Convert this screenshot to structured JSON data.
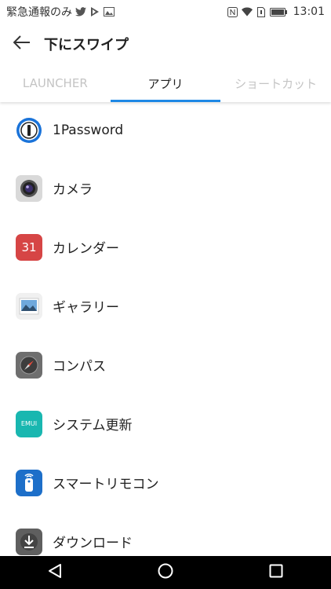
{
  "status_bar": {
    "left_text": "緊急通報のみ",
    "time": "13:01",
    "left_icons": [
      "twitter-icon",
      "play-store-icon",
      "gallery-icon"
    ],
    "right_icons": [
      "nfc-icon",
      "wifi-icon",
      "sim-icon",
      "battery-icon"
    ]
  },
  "toolbar": {
    "title": "下にスワイプ",
    "back_icon": "arrow-left-icon"
  },
  "tabs": [
    {
      "label": "LAUNCHER",
      "active": false
    },
    {
      "label": "アプリ",
      "active": true
    },
    {
      "label": "ショートカット",
      "active": false
    }
  ],
  "apps": [
    {
      "label": "1Password",
      "icon": "1password-icon"
    },
    {
      "label": "カメラ",
      "icon": "camera-icon"
    },
    {
      "label": "カレンダー",
      "icon": "calendar-icon",
      "icon_text": "31"
    },
    {
      "label": "ギャラリー",
      "icon": "gallery-icon"
    },
    {
      "label": "コンパス",
      "icon": "compass-icon"
    },
    {
      "label": "システム更新",
      "icon": "system-update-icon",
      "icon_text": "EMUI"
    },
    {
      "label": "スマートリモコン",
      "icon": "smart-remote-icon"
    },
    {
      "label": "ダウンロード",
      "icon": "download-icon"
    }
  ],
  "nav_bar": [
    "back-triangle-icon",
    "home-circle-icon",
    "recents-square-icon"
  ],
  "colors": {
    "accent": "#1e88e5",
    "calendar": "#d64545",
    "emui": "#19b7b0",
    "remote": "#1d6fc9"
  }
}
